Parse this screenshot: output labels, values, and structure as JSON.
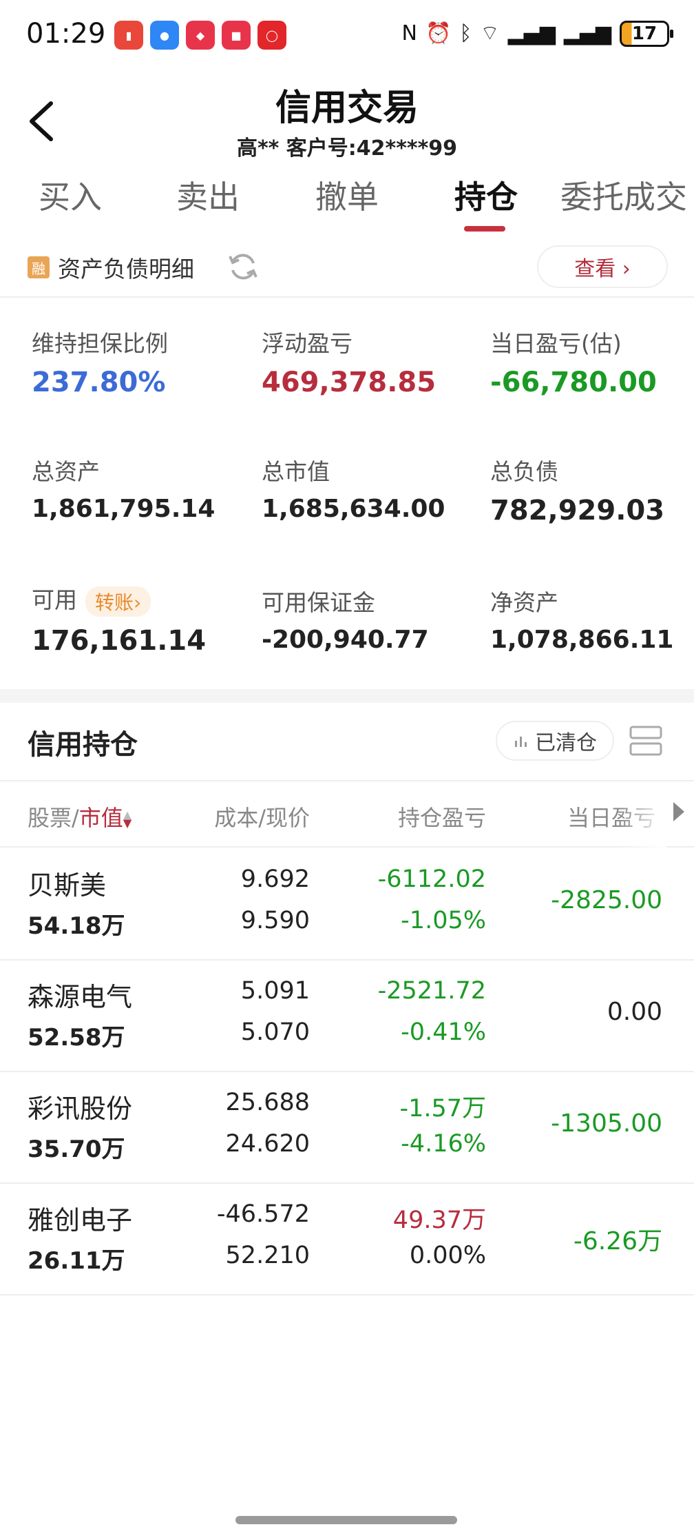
{
  "status_bar": {
    "time": "01:29",
    "battery": "17",
    "notifications": [
      {
        "icon": "red-app-icon",
        "color": "#e8473a"
      },
      {
        "icon": "message-app-icon",
        "color": "#2f86f5"
      },
      {
        "icon": "app-gallery-icon",
        "color": "#e8344a"
      },
      {
        "icon": "shopping-app-icon",
        "color": "#e8344a"
      },
      {
        "icon": "byd-app-icon",
        "color": "#e2262a"
      }
    ]
  },
  "header": {
    "title": "信用交易",
    "subtitle": "高**  客户号:42****99"
  },
  "tabs": [
    "买入",
    "卖出",
    "撤单",
    "持仓",
    "委托成交"
  ],
  "active_tab": "持仓",
  "asset_bar": {
    "badge": "融",
    "label": "资产负债明细",
    "view_button": "查看 ›"
  },
  "metrics": {
    "maintenance_ratio": {
      "label": "维持担保比例",
      "value": "237.80%"
    },
    "floating_pl": {
      "label": "浮动盈亏",
      "value": "469,378.85"
    },
    "daily_pl": {
      "label": "当日盈亏(估)",
      "value": "-66,780.00"
    },
    "total_assets": {
      "label": "总资产",
      "value": "1,861,795.14"
    },
    "total_market_value": {
      "label": "总市值",
      "value": "1,685,634.00"
    },
    "total_liabilities": {
      "label": "总负债",
      "value": "782,929.03"
    },
    "available": {
      "label": "可用",
      "value": "176,161.14",
      "transfer": "转账›"
    },
    "available_margin": {
      "label": "可用保证金",
      "value": "-200,940.77"
    },
    "net_assets": {
      "label": "净资产",
      "value": "1,078,866.11"
    }
  },
  "holdings": {
    "title": "信用持仓",
    "cleared_button": "已清仓",
    "columns": {
      "stock_prefix": "股票/",
      "stock_sort": "市值",
      "cost_price": "成本/现价",
      "position_pl": "持仓盈亏",
      "daily_pl": "当日盈亏"
    },
    "rows": [
      {
        "name": "贝斯美",
        "market_value": "54.18万",
        "cost": "9.692",
        "price": "9.590",
        "pl": "-6112.02",
        "pl_pct": "-1.05%",
        "today": "-2825.00"
      },
      {
        "name": "森源电气",
        "market_value": "52.58万",
        "cost": "5.091",
        "price": "5.070",
        "pl": "-2521.72",
        "pl_pct": "-0.41%",
        "today": "0.00"
      },
      {
        "name": "彩讯股份",
        "market_value": "35.70万",
        "cost": "25.688",
        "price": "24.620",
        "pl": "-1.57万",
        "pl_pct": "-4.16%",
        "today": "-1305.00"
      },
      {
        "name": "雅创电子",
        "market_value": "26.11万",
        "cost": "-46.572",
        "price": "52.210",
        "pl": "49.37万",
        "pl_pct": "0.00%",
        "today": "-6.26万"
      }
    ]
  },
  "colors": {
    "accent_red": "#c8313c",
    "profit_red": "#b72d3d",
    "loss_green": "#1a9a24",
    "ratio_blue": "#3c6bd6"
  }
}
